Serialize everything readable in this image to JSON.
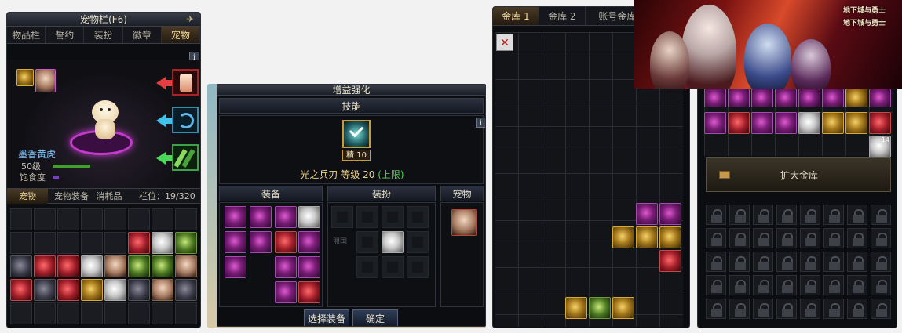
{
  "pet_panel": {
    "title": "宠物栏(F6)",
    "tabs": [
      "物品栏",
      "誓约",
      "装扮",
      "徽章",
      "宠物"
    ],
    "active_tab": 4,
    "info_label": "i",
    "pet_name": "墨香黄虎",
    "pet_level": "50级",
    "satiety_label": "饱食度",
    "bottom_tabs": [
      "宠物",
      "宠物装备",
      "消耗品"
    ],
    "capacity_label": "栏位：19/320"
  },
  "buff_panel": {
    "title": "增益强化",
    "skill_header": "技能",
    "info_label": "i",
    "skill_badge": "精 10",
    "skill_line_name": "光之兵刃",
    "skill_line_level": "等级 20",
    "skill_line_cap": "(上限)",
    "section_equipment": "装备",
    "section_costume": "装扮",
    "section_pet": "宠物",
    "select_button": "选择装备",
    "confirm_button": "确定",
    "under_label": "盟国"
  },
  "vault_panel": {
    "tabs": [
      "金库 1",
      "金库 2",
      "账号金库"
    ],
    "active_tab": 0
  },
  "vault_right": {
    "expand_label": "扩大金库",
    "stack_count": "14"
  },
  "banner": {
    "logo_text": "地下城与勇士"
  },
  "colors": {
    "accent_gold": "#f3d99a",
    "skill_text": "#f0d68a",
    "cap_text": "#4fd04a",
    "level_bar": "#3fa02a",
    "satiety_bar": "#7a3fbf"
  }
}
